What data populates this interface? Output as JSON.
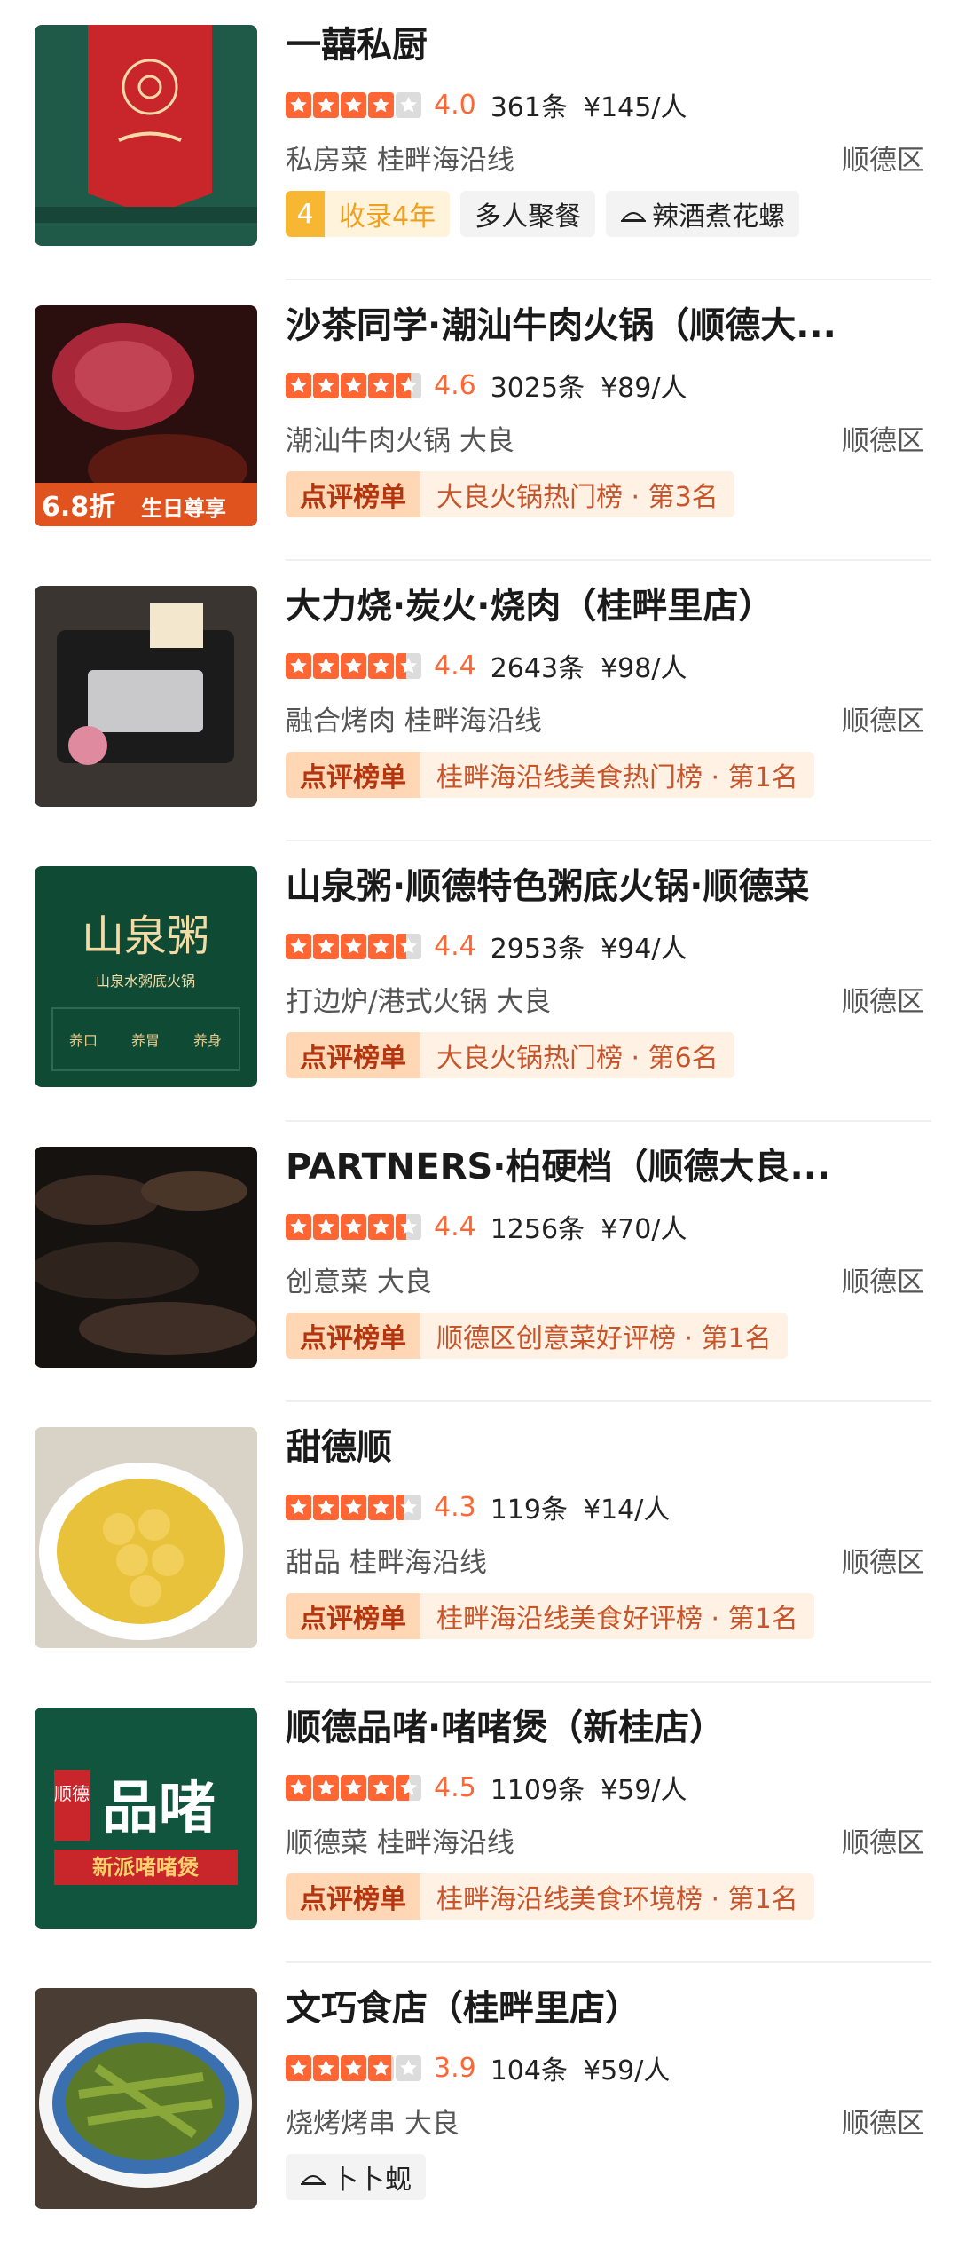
{
  "colors": {
    "accent": "#ff6633",
    "rank_bg": "#ffd7b5",
    "rank_text": "#c8552a"
  },
  "restaurants": [
    {
      "name": "一囍私厨",
      "rating": 4.0,
      "score": "4.0",
      "reviews": "361条",
      "price": "¥145/人",
      "cuisine": "私房菜 桂畔海沿线",
      "district": "顺德区",
      "years_num": "4",
      "years_label": "收录4年",
      "tags": [
        "多人聚餐",
        "辣酒煮花螺"
      ]
    },
    {
      "name": "沙茶同学·潮汕牛肉火锅（顺德大...",
      "rating": 4.6,
      "score": "4.6",
      "reviews": "3025条",
      "price": "¥89/人",
      "cuisine": "潮汕牛肉火锅 大良",
      "district": "顺德区",
      "rank_label": "点评榜单",
      "rank_text": "大良火锅热门榜 · 第3名",
      "thumb_text": {
        "promo": "6.8折",
        "promo_sub": "生日尊享"
      }
    },
    {
      "name": "大力烧·炭火·烧肉（桂畔里店）",
      "rating": 4.4,
      "score": "4.4",
      "reviews": "2643条",
      "price": "¥98/人",
      "cuisine": "融合烤肉 桂畔海沿线",
      "district": "顺德区",
      "rank_label": "点评榜单",
      "rank_text": "桂畔海沿线美食热门榜 · 第1名"
    },
    {
      "name": "山泉粥·顺德特色粥底火锅·顺德菜",
      "rating": 4.4,
      "score": "4.4",
      "reviews": "2953条",
      "price": "¥94/人",
      "cuisine": "打边炉/港式火锅 大良",
      "district": "顺德区",
      "rank_label": "点评榜单",
      "rank_text": "大良火锅热门榜 · 第6名",
      "thumb_text": {
        "logo": "山泉粥",
        "sub": "山泉水粥底火锅",
        "cells": [
          "养口",
          "养胃",
          "养身"
        ]
      }
    },
    {
      "name": "PARTNERS·柏硬档（顺德大良...",
      "rating": 4.4,
      "score": "4.4",
      "reviews": "1256条",
      "price": "¥70/人",
      "cuisine": "创意菜 大良",
      "district": "顺德区",
      "rank_label": "点评榜单",
      "rank_text": "顺德区创意菜好评榜 · 第1名"
    },
    {
      "name": "甜德顺",
      "rating": 4.3,
      "score": "4.3",
      "reviews": "119条",
      "price": "¥14/人",
      "cuisine": "甜品 桂畔海沿线",
      "district": "顺德区",
      "rank_label": "点评榜单",
      "rank_text": "桂畔海沿线美食好评榜 · 第1名"
    },
    {
      "name": "顺德品啫·啫啫煲（新桂店）",
      "rating": 4.5,
      "score": "4.5",
      "reviews": "1109条",
      "price": "¥59/人",
      "cuisine": "顺德菜 桂畔海沿线",
      "district": "顺德区",
      "rank_label": "点评榜单",
      "rank_text": "桂畔海沿线美食环境榜 · 第1名",
      "thumb_text": {
        "brand": "顺德",
        "logo": "品啫",
        "banner": "新派啫啫煲"
      }
    },
    {
      "name": "文巧食店（桂畔里店）",
      "rating": 3.9,
      "score": "3.9",
      "reviews": "104条",
      "price": "¥59/人",
      "cuisine": "烧烤烤串 大良",
      "district": "顺德区",
      "tags": [
        "卜卜蚬"
      ]
    }
  ]
}
